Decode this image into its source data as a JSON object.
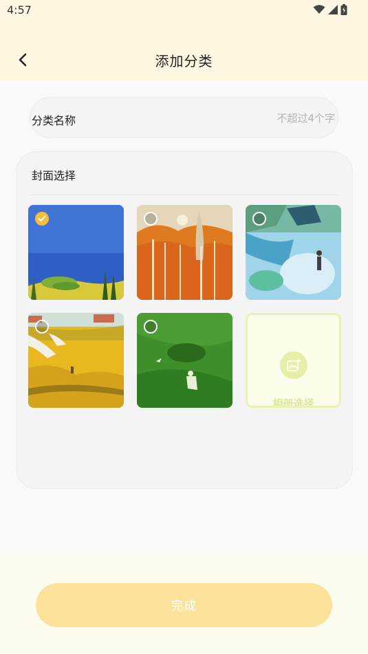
{
  "status_bar": {
    "time": "4:57"
  },
  "header": {
    "title": "添加分类"
  },
  "category_name": {
    "label": "分类名称",
    "placeholder": "不超过4个字",
    "value": ""
  },
  "cover": {
    "title": "封面选择",
    "selected_index": 0,
    "images": [
      {
        "name": "blue-sea-painting",
        "checked": true
      },
      {
        "name": "autumn-forest-painting",
        "checked": false
      },
      {
        "name": "rain-walker-painting",
        "checked": false
      },
      {
        "name": "wheat-field-painting",
        "checked": false
      },
      {
        "name": "green-grass-painting",
        "checked": false
      }
    ],
    "album_label": "相册选择"
  },
  "footer": {
    "done_label": "完成"
  },
  "colors": {
    "header_bg": "#fef7e2",
    "accent": "#f8bd39",
    "done_button": "#fce29a",
    "album_accent": "#e6efa8"
  }
}
